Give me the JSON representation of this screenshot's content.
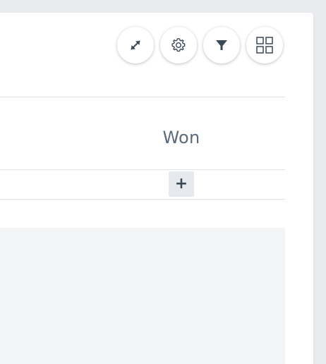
{
  "board": {
    "column_title": "Won",
    "add_label": "+"
  },
  "toolbar": {
    "buttons": [
      {
        "icon": "expand-icon"
      },
      {
        "icon": "gear-icon"
      },
      {
        "icon": "filter-icon"
      },
      {
        "icon": "grid-icon"
      }
    ]
  },
  "colors": {
    "text": "#5b6b7b",
    "icon": "#3b4858",
    "divider": "#dfe3e8",
    "content_bg": "#f4f5f7",
    "page_bg": "#e9ebef"
  }
}
